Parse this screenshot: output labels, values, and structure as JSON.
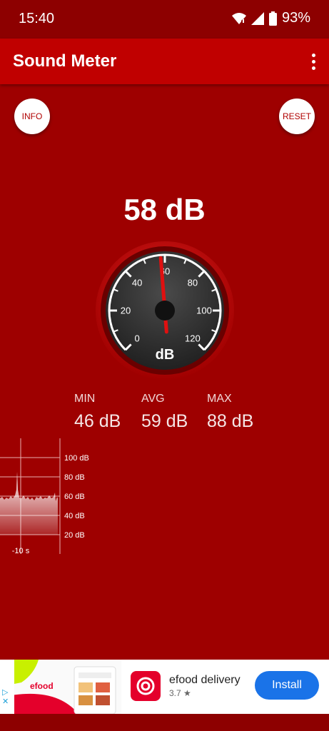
{
  "status_bar": {
    "time": "15:40",
    "battery": "93%"
  },
  "app_bar": {
    "title": "Sound Meter"
  },
  "buttons": {
    "info": "INFO",
    "reset": "RESET"
  },
  "readout": "58 dB",
  "gauge": {
    "value_db": 58,
    "min_db": 0,
    "max_db": 120,
    "tick_labels": [
      "0",
      "20",
      "40",
      "60",
      "80",
      "100",
      "120"
    ],
    "unit": "dB",
    "needle_color": "#e01010"
  },
  "stats": {
    "min": {
      "label": "MIN",
      "value": "46 dB"
    },
    "avg": {
      "label": "AVG",
      "value": "59 dB"
    },
    "max": {
      "label": "MAX",
      "value": "88 dB"
    }
  },
  "history": {
    "y_labels": [
      "100 dB",
      "80 dB",
      "60 dB",
      "40 dB",
      "20 dB"
    ],
    "x_label": "-10 s"
  },
  "ad": {
    "thumb_logo": "efood",
    "title": "efood delivery",
    "rating": "3.7 ★",
    "install": "Install",
    "brand_color": "#e4002b",
    "button_color": "#1a73e8"
  },
  "colors": {
    "background": "#9e0000",
    "app_bar": "#c00000",
    "status_bar": "#8d0000"
  }
}
